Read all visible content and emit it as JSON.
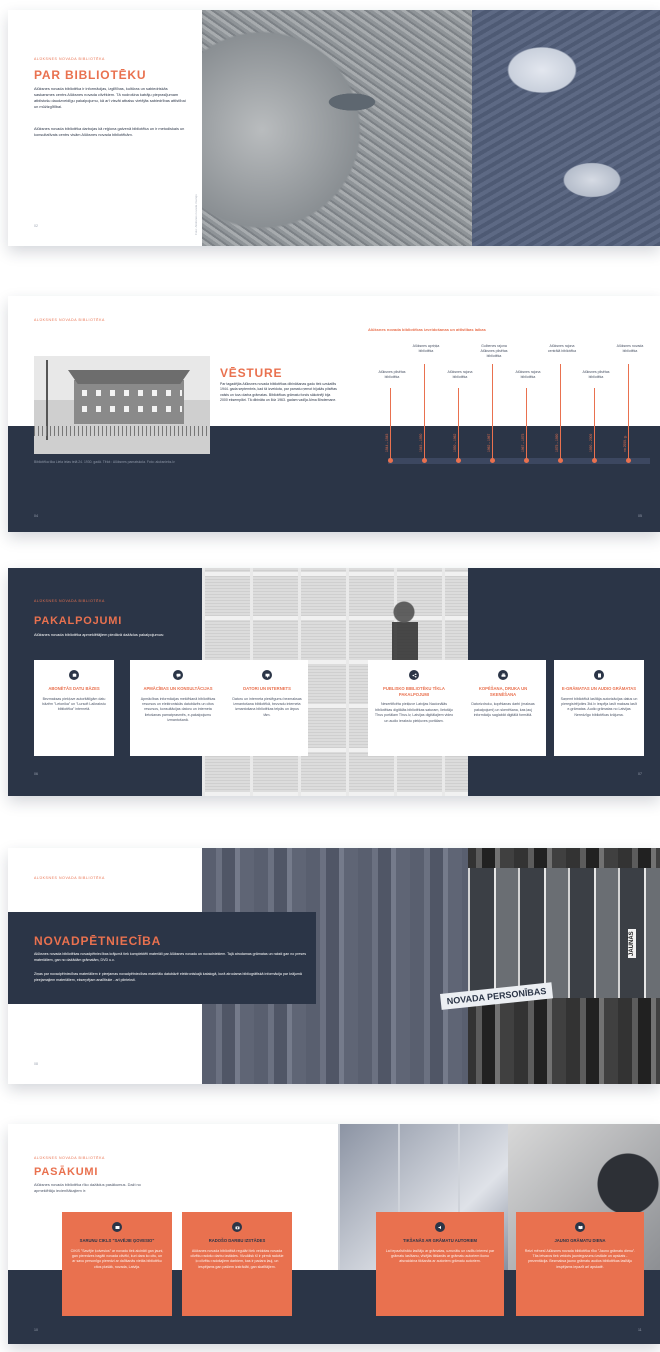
{
  "spread1": {
    "eyebrow": "ALŪKSNES NOVADA BIBLIOTĒKA",
    "title": "PAR BIBLIOTĒKU",
    "para1": "Alūksnes novada bibliotēka ir informācijas, izglītības, kultūras un sabiedriskās saskarsmes centrs Alūksnes novada cilvēkiem. Tā nodrošina katrāju pieprasījumam atbilstošu daudzveidīgu pakalpojumu, kā arī visvāt atbalsu vietējās sabiedrības attīstībai un mūžizglītībai.",
    "para2": "Alūksnes novada bibliotēka darbojas kā reģiona galvenā bibliotēka un ir metodiskais un konsultatīvais centrs visām Alūksnes novada bibliotēkām.",
    "vertical_caption": "Foto: Alūksnes novada muzejs",
    "page": "02"
  },
  "spread2": {
    "eyebrow": "ALŪKSNES NOVADA BIBLIOTĒKA",
    "title": "VĒSTURE",
    "body": "Par tagadējās Alūksnes novada bibliotēkas dibināšanas gadu tiek uzskatīts 1944. gada septembris, kad tā izveidota, par pamatu ņemot bijušās pilsētas valsts un tuvu darba grāmatas. Bibliotēkas grāmatu fonds sākotnēji bija 2000 eksemplāri. Tā dibināta un līdz 1963. gadam vadīja Alma Bindemane.",
    "photo_caption": "Bibliotēka tika Liela ielas telā 24. 1930. gadā. Tēlot : Alūksnes pamatskola. Foto: aluksnieks.lv",
    "timeline_title": "Alūksnes novada bibliotēkas izveidošanas un attīstības laikas",
    "timeline": [
      {
        "label": "Alūksnes pilsētas bibliotēka",
        "year": "1944 – 1945"
      },
      {
        "label": "Alūksnes apriņķa bibliotēka",
        "year": "1945 – 1950"
      },
      {
        "label": "Alūksnes rajona bibliotēka",
        "year": "1950 – 1962"
      },
      {
        "label": "Gulbenes rajona Alūksnes pilsētas bibliotēka",
        "year": "1962 – 1967"
      },
      {
        "label": "Alūksnes rajona bibliotēka",
        "year": "1967 – 1975"
      },
      {
        "label": "Alūksnes rajona centrālā bibliotēka",
        "year": "1975 – 1990"
      },
      {
        "label": "Alūksnes pilsētas bibliotēka",
        "year": "1990 – 2009"
      },
      {
        "label": "Alūksnes novada bibliotēka",
        "year": "no 2009. g."
      }
    ],
    "page_left": "04",
    "page_right": "05"
  },
  "spread3": {
    "eyebrow": "ALŪKSNES NOVADA BIBLIOTĒKA",
    "title": "PAKALPOJUMI",
    "body": "Alūksnes novada bibliotēka apmeklētājiem piedāvā dažādus pakalpojumus:",
    "services": [
      {
        "icon": "database-icon",
        "title": "ABONĒTĀS DATU BĀZES",
        "desc": "Bezmaksas piekļuve autoritātīgām datu bāzēm \"Letonika\" un \"Lursoft Laikrakstu bibliotēka\" internetā."
      },
      {
        "icon": "chat-icon",
        "title": "APMĀCĪBAS UN KONSULTĀCIJAS",
        "desc": "Apmācības informācijas meklēšanā bibliotēkas resursos un elektroniskās datubāzēs un citos resursos, konsultācijas datoru un interneta lietošanas pamatprasmēs, e-pakalpojumu izmantošanā."
      },
      {
        "icon": "monitor-icon",
        "title": "DATORI UN INTERNETS",
        "desc": "Datoru un interneta pieslēgumu bezmaksas izmantošana bibliotēkā, bezvadu interneta izmantošana bibliotēkas telpās un ārpus tām."
      },
      {
        "icon": "share-icon",
        "title": "PUBLISKO BIBLIOTĒKU TĪKLA PAKALPOJUMI",
        "desc": "Nesertificēta piekļuve Latvijas Nacionālās bibliotēkas digitālās bibliotēkas saturam, lietotāju Tīrus portālam Tīrus.lv, Latvijas digitālajiem video un audio ierakstu piekļuves portālam."
      },
      {
        "icon": "printer-icon",
        "title": "KOPĒŠANA, DRUKA UN SKENĒŠANA",
        "desc": "Datorizdruku, kopēšanas darbi (maksas pakalpojumi) un skenēšana, kas ļauj informāciju saglabāt digitālā formātā."
      },
      {
        "icon": "book-icon",
        "title": "E-GRĀMATAS UN AUDIO GRĀMATAS",
        "desc": "Saņemt bibliotēkā lasītāja autorizācijas datus un pieregistrējoties 3td.lv iespēja lasīt maksas lasīt e-grāmatas. Audio grāmatas no Latvijas Neredzīgo bibliotēkas krājuma."
      }
    ],
    "page_left": "06",
    "page_right": "07"
  },
  "spread4": {
    "eyebrow": "ALŪKSNES NOVADA BIBLIOTĒKA",
    "title": "NOVADPĒTNIECĪBA",
    "para1": "Alūksnes novada bibliotēkas novadpētniecības krājumā tiek komplektēti materiāli par Alūksnes novadu un novadniekiem. Tajā atrodamas grāmatas un raksti gan no preses materiāliem, gan no dažādām grāmatām, DVD u.c.",
    "para2": "Ziņas par novadpētniecības materiāliem ir pieejamas novadpētniecības materiālu datubāzē elektroniskajā katalogā, kurā atrodama bibliogrāfiskā informācija par krājumā pieejamajiem materiāliem, ekserpējam analītiskie - arī pilnteksti.",
    "shelf_label": "NOVADA PERSONĪBAS",
    "book_spine": "JAUNĀS",
    "page": "08"
  },
  "spread5": {
    "eyebrow": "ALŪKSNES NOVADA BIBLIOTĒKA",
    "title": "PASĀKUMI",
    "body": "Alūksnes novada bibliotēka rīko dažādus pasākumus. Daži no apmeklētāju iecienītākajiem ir:",
    "events": [
      {
        "icon": "film-icon",
        "title": "SARUNU CIKLS \"SAVĒJIE ĢOVESIO\"",
        "desc": "CIKlS \"Savējie ķolvesios\" ar novadu tiek aicināti gan jauni, gan pieredzes bagāti novada cilvēki, kuri dara ko citu, un ar savu personīgo pieredzi ar dalīšanās vietās bibliotēku citos plašāk, novada, Latvija."
      },
      {
        "icon": "camera-icon",
        "title": "RADOŠO DARBU IZSTĀDES",
        "desc": "Alūksnes novada bibliotēkā regulāri tiek veidotas novada cilvēku radošo darbu izstādes. Vizuālisk šī ir pirmā radošie ļo cilvēku radošajiem darbiem, kas ir padara ļauj, un iespējams gan pašiem izstrādāt, gan skatītājiem."
      },
      {
        "icon": "speaker-icon",
        "title": "TIKŠANĀS AR GRĀMATU AUTORIEM",
        "desc": "Lai iepazīstinātu lasītāju ar grāmatas, uzrunātu un radītu interesi par grāmatu lasīšanu, vīsējās tikšanās ar grāmatu autoriem ikonu atsvaidzina tikšanās ar autoriem grāmatu autoriem."
      },
      {
        "icon": "book-open-icon",
        "title": "JAUNO GRĀMATU DIENA",
        "desc": "Reizi mēnesī Alūksnes novada bibliotēka rīko \"Jauno grāmatu dienu\". Tās ietvaros tiek veidots jaunieguvumu izstāde un apskats - prezentācija. Bezmaksa jauno grāmatu audios bibliotēkas lasītāju iespējams iepazīt arī apskatē."
      }
    ],
    "page_left": "10",
    "page_right": "11"
  },
  "colors": {
    "navy": "#2b3547",
    "coral": "#e9714f",
    "white": "#ffffff"
  }
}
